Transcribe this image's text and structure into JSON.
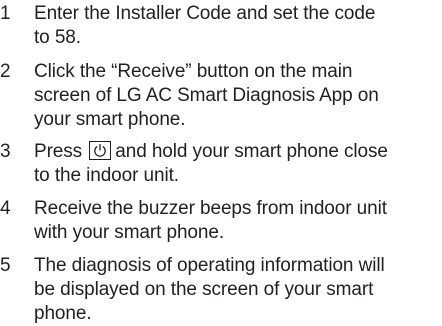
{
  "steps": [
    {
      "number": "1",
      "lines": [
        "Enter the Installer Code and set the code",
        "to 58."
      ]
    },
    {
      "number": "2",
      "lines": [
        "Click the “Receive” button on the main",
        "screen of LG AC Smart Diagnosis App on",
        "your smart phone."
      ]
    },
    {
      "number": "3",
      "line1_before_icon": "Press",
      "line1_after_icon": "and hold your smart phone close",
      "line2": "to the indoor unit."
    },
    {
      "number": "4",
      "lines": [
        "Receive the buzzer beeps from indoor unit",
        "with your smart phone."
      ]
    },
    {
      "number": "5",
      "lines": [
        "The diagnosis of operating information will",
        "be displayed on the screen of your smart",
        "phone."
      ]
    }
  ],
  "icons": {
    "power_button": "power-icon"
  }
}
